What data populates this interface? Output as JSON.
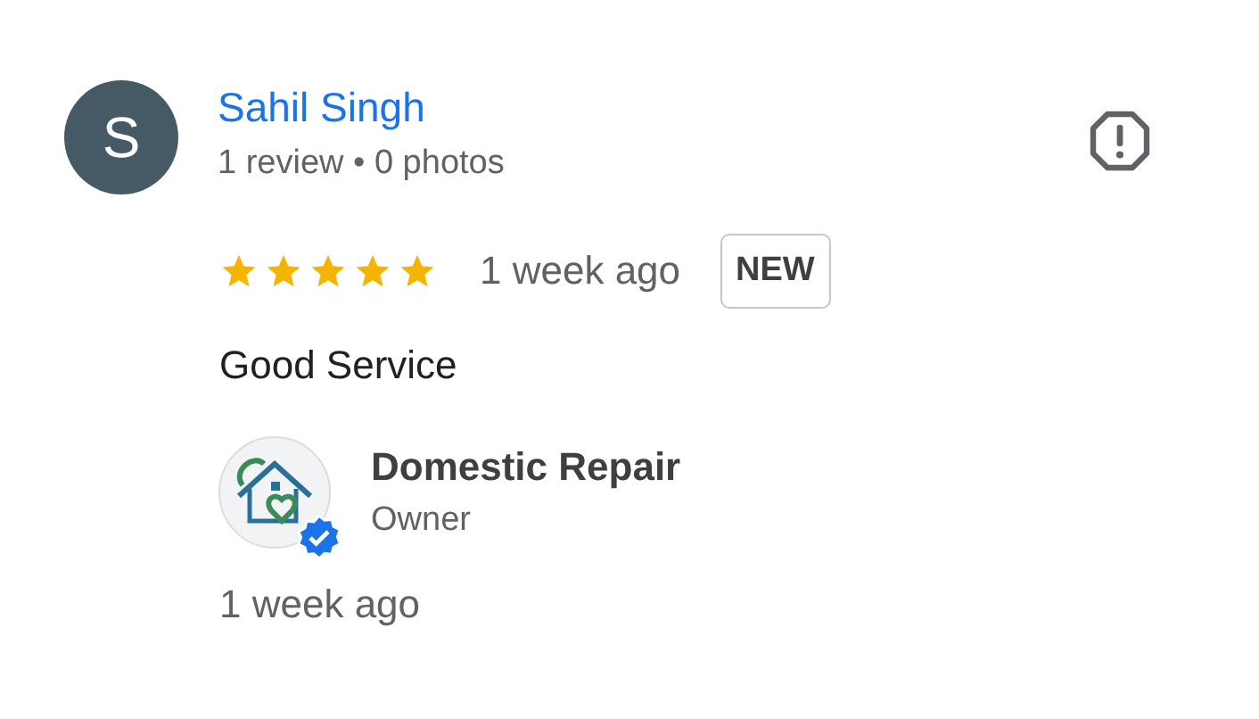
{
  "review": {
    "avatar_letter": "S",
    "author": "Sahil Singh",
    "author_stats": "1 review • 0 photos",
    "stars": 5,
    "time": "1 week ago",
    "badge": "NEW",
    "text": "Good Service"
  },
  "owner_response": {
    "name": "Domestic Repair",
    "role": "Owner",
    "verified": true,
    "time": "1 week ago"
  }
}
